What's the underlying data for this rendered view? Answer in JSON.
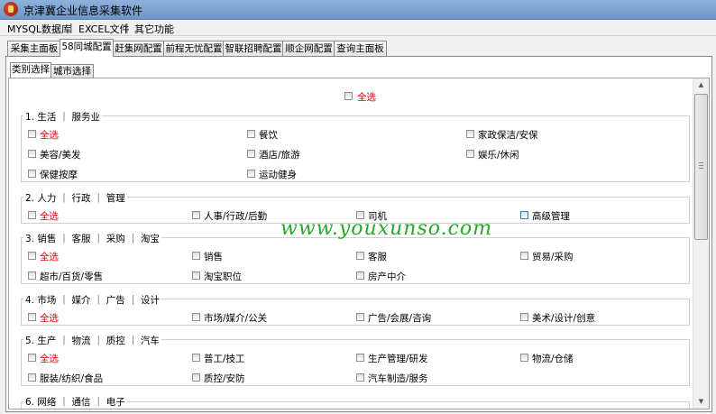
{
  "window": {
    "title": "京津冀企业信息采集软件"
  },
  "menu": [
    {
      "label": "MYSQL数据库"
    },
    {
      "label": "EXCEL文件"
    },
    {
      "label": "其它功能"
    }
  ],
  "menu_separator": "|",
  "tabs": [
    "采集主面板",
    "58同城配置",
    "赶集网配置",
    "前程无忧配置",
    "智联招聘配置",
    "顺企网配置",
    "查询主面板"
  ],
  "subtabs": [
    "类别选择",
    "城市选择"
  ],
  "select_all_label": "全选",
  "watermark": "www.youxunso.com",
  "groups": [
    {
      "title": "1. 生活 ｜ 服务业",
      "items": [
        "全选",
        "餐饮",
        "家政保洁/安保",
        "美容/美发",
        "酒店/旅游",
        "娱乐/休闲",
        "保健按摩",
        "运动健身"
      ]
    },
    {
      "title": "2. 人力 ｜ 行政 ｜ 管理",
      "items": [
        "全选",
        "人事/行政/后勤",
        "司机",
        "高级管理"
      ]
    },
    {
      "title": "3. 销售 ｜ 客服 ｜ 采购 ｜ 淘宝",
      "items": [
        "全选",
        "销售",
        "客服",
        "贸易/采购",
        "超市/百货/零售",
        "淘宝职位",
        "房产中介"
      ]
    },
    {
      "title": "4. 市场 ｜ 媒介 ｜ 广告 ｜ 设计",
      "items": [
        "全选",
        "市场/媒介/公关",
        "广告/会展/咨询",
        "美术/设计/创意"
      ]
    },
    {
      "title": "5. 生产 ｜ 物流 ｜ 质控 ｜ 汽车",
      "items": [
        "全选",
        "普工/技工",
        "生产管理/研发",
        "物流/仓储",
        "服装/纺织/食品",
        "质控/安防",
        "汽车制造/服务"
      ]
    },
    {
      "title": "6. 网络 ｜ 通信 ｜ 电子",
      "items": []
    }
  ]
}
